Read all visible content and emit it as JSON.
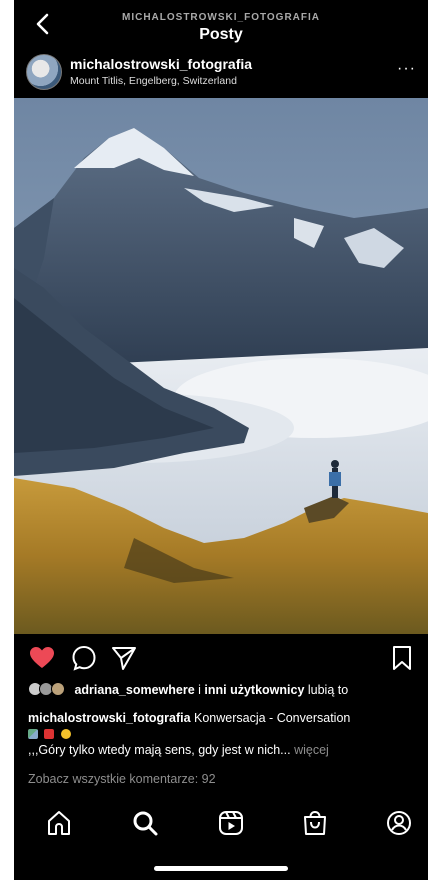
{
  "header": {
    "account_caps": "MICHALOSTROWSKI_FOTOGRAFIA",
    "title": "Posty"
  },
  "post": {
    "username": "michalostrowski_fotografia",
    "location": "Mount Titlis, Engelberg, Switzerland",
    "more_symbol": "···",
    "liked": true,
    "likes": {
      "liker": "adriana_somewhere",
      "rest": " i ",
      "others": "inni użytkownicy",
      "suffix": " lubią to"
    },
    "caption": {
      "author": "michalostrowski_fotografia",
      "first_line": " Konwersacja - Conversation",
      "emoji": [
        "mountain",
        "red-flag",
        "smiling-face"
      ],
      "text": ",,,Góry tylko wtedy mają sens, gdy jest w nich...",
      "more": " więcej"
    },
    "comments_link": "Zobacz wszystkie komentarze: 92"
  },
  "colors": {
    "background": "#000000",
    "like_red": "#ed4956",
    "muted": "#8e8e8e"
  },
  "icons": {
    "header": [
      "back-chevron-icon"
    ],
    "actions": [
      "heart-icon",
      "comment-icon",
      "share-icon",
      "bookmark-icon"
    ],
    "tabs": [
      "home-icon",
      "search-icon",
      "reels-icon",
      "shop-icon",
      "profile-icon"
    ]
  },
  "tabs": {
    "active": "search"
  }
}
